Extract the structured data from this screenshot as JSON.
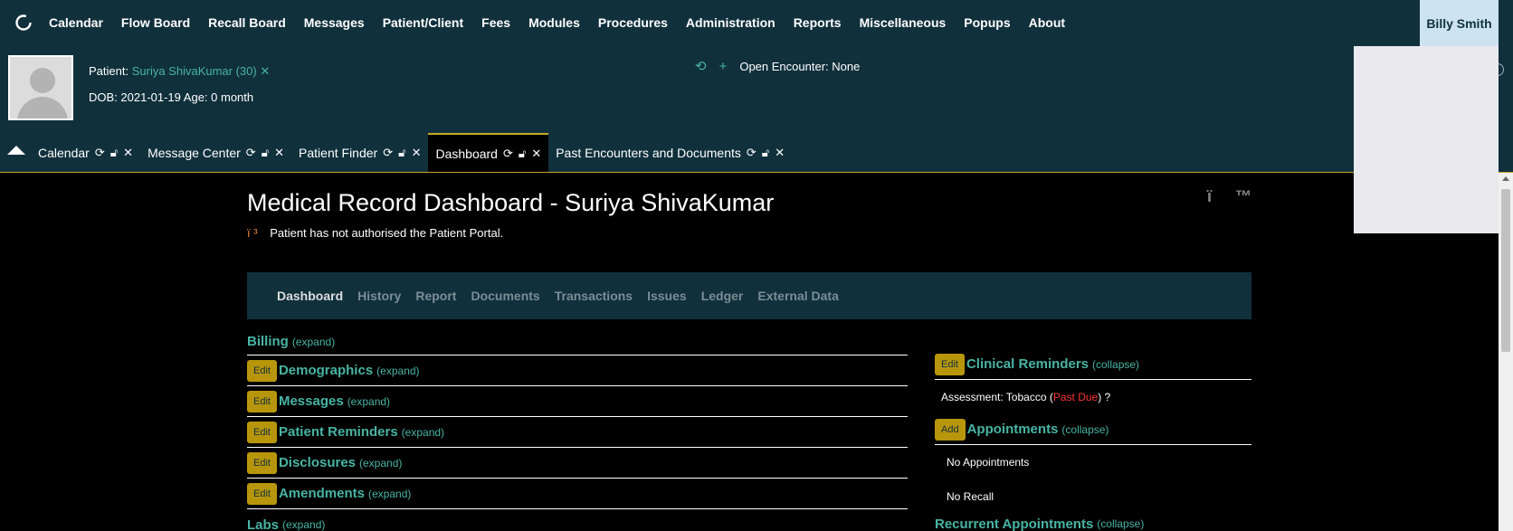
{
  "nav": {
    "menu": [
      "Calendar",
      "Flow Board",
      "Recall Board",
      "Messages",
      "Patient/Client",
      "Fees",
      "Modules",
      "Procedures",
      "Administration",
      "Reports",
      "Miscellaneous",
      "Popups",
      "About"
    ],
    "user": "Billy Smith"
  },
  "patient": {
    "label": "Patient:",
    "name": "Suriya ShivaKumar (30)",
    "close": "✕",
    "dob_line": "DOB: 2021-01-19 Age: 0 month"
  },
  "encounter": {
    "text": "Open Encounter: None"
  },
  "tabs": [
    {
      "label": "Calendar",
      "active": false
    },
    {
      "label": "Message Center",
      "active": false
    },
    {
      "label": "Patient Finder",
      "active": false
    },
    {
      "label": "Dashboard",
      "active": true
    },
    {
      "label": "Past Encounters and Documents",
      "active": false
    }
  ],
  "main": {
    "title": "Medical Record Dashboard - Suriya ShivaKumar",
    "warning": "Patient has not authorised the Patient Portal.",
    "warning_icon": "ï ³",
    "corner_left": "ï",
    "corner_right": "™",
    "subnav": [
      "Dashboard",
      "History",
      "Report",
      "Documents",
      "Transactions",
      "Issues",
      "Ledger",
      "External Data"
    ],
    "left_sections": [
      {
        "name": "Billing",
        "toggle": "(expand)",
        "button": ""
      },
      {
        "name": "Demographics",
        "toggle": "(expand)",
        "button": "Edit"
      },
      {
        "name": "Messages",
        "toggle": "(expand)",
        "button": "Edit"
      },
      {
        "name": "Patient Reminders",
        "toggle": "(expand)",
        "button": "Edit"
      },
      {
        "name": "Disclosures",
        "toggle": "(expand)",
        "button": "Edit"
      },
      {
        "name": "Amendments",
        "toggle": "(expand)",
        "button": "Edit"
      },
      {
        "name": "Labs",
        "toggle": "(expand)",
        "button": ""
      }
    ],
    "right": {
      "clinical": {
        "button": "Edit",
        "name": "Clinical Reminders",
        "toggle": "(collapse)"
      },
      "reminder": {
        "prefix": "Assessment: Tobacco  (",
        "status": "Past Due",
        "suffix": ") ?"
      },
      "appointments": {
        "button": "Add",
        "name": "Appointments",
        "toggle": "(collapse)"
      },
      "no_appointments": "No Appointments",
      "no_recall": "No Recall",
      "recurrent": {
        "name": "Recurrent Appointments",
        "toggle": "(collapse)"
      }
    }
  }
}
